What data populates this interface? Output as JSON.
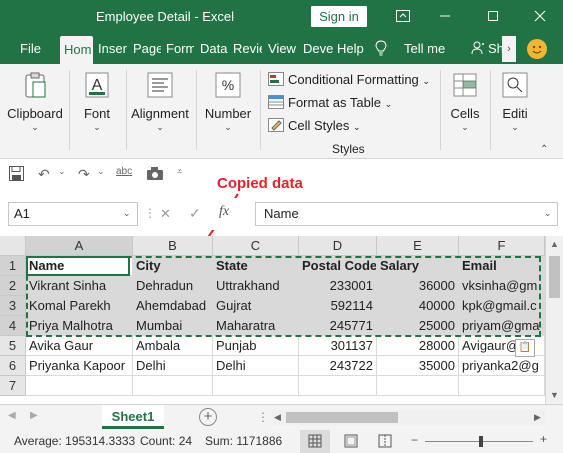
{
  "window": {
    "title": "Employee Detail  -  Excel",
    "signin": "Sign in"
  },
  "tabs": [
    "File",
    "Home",
    "Insert",
    "Page Layout",
    "Formulas",
    "Data",
    "Review",
    "View",
    "Developer",
    "Help",
    "Tell me",
    "Share"
  ],
  "tabs_display": [
    "File",
    "Hom",
    "Inser",
    "Page",
    "Form",
    "Data",
    "Revie",
    "View",
    "Deve",
    "Help",
    "Tell me",
    "Sh"
  ],
  "ribbon": {
    "clipboard": "Clipboard",
    "font": "Font",
    "alignment": "Alignment",
    "number": "Number",
    "conditional_formatting": "Conditional Formatting",
    "format_as_table": "Format as Table",
    "cell_styles": "Cell Styles",
    "styles_group": "Styles",
    "cells": "Cells",
    "editing": "Editi"
  },
  "formula": {
    "namebox": "A1",
    "fx": "fx",
    "content": "Name"
  },
  "annotation": "Copied data",
  "columns": [
    "A",
    "B",
    "C",
    "D",
    "E",
    "F"
  ],
  "rows": [
    "1",
    "2",
    "3",
    "4",
    "5",
    "6",
    "7"
  ],
  "table": [
    [
      "Name",
      "City",
      "State",
      "Postal Code",
      "Salary",
      "Email"
    ],
    [
      "Vikrant Sinha",
      "Dehradun",
      "Uttrakhand",
      "233001",
      "36000",
      "vksinha@gm"
    ],
    [
      "Komal Parekh",
      "Ahemdabad",
      "Gujrat",
      "592114",
      "40000",
      "kpk@gmail.c"
    ],
    [
      "Priya Malhotra",
      "Mumbai",
      "Maharatra",
      "245771",
      "25000",
      "priyam@gma"
    ],
    [
      "Avika Gaur",
      "Ambala",
      "Punjab",
      "301137",
      "28000",
      "Avigaur@"
    ],
    [
      "Priyanka Kapoor",
      "Delhi",
      "Delhi",
      "243722",
      "35000",
      "priyanka2@g"
    ],
    [
      "",
      "",
      "",
      "",
      "",
      ""
    ]
  ],
  "sheet": {
    "name": "Sheet1"
  },
  "status": {
    "average": "Average: 195314.3333",
    "count": "Count: 24",
    "sum": "Sum: 1171886"
  },
  "colors": {
    "accent": "#217346",
    "annotation": "#e8202a",
    "selection": "#d9d9d9"
  }
}
